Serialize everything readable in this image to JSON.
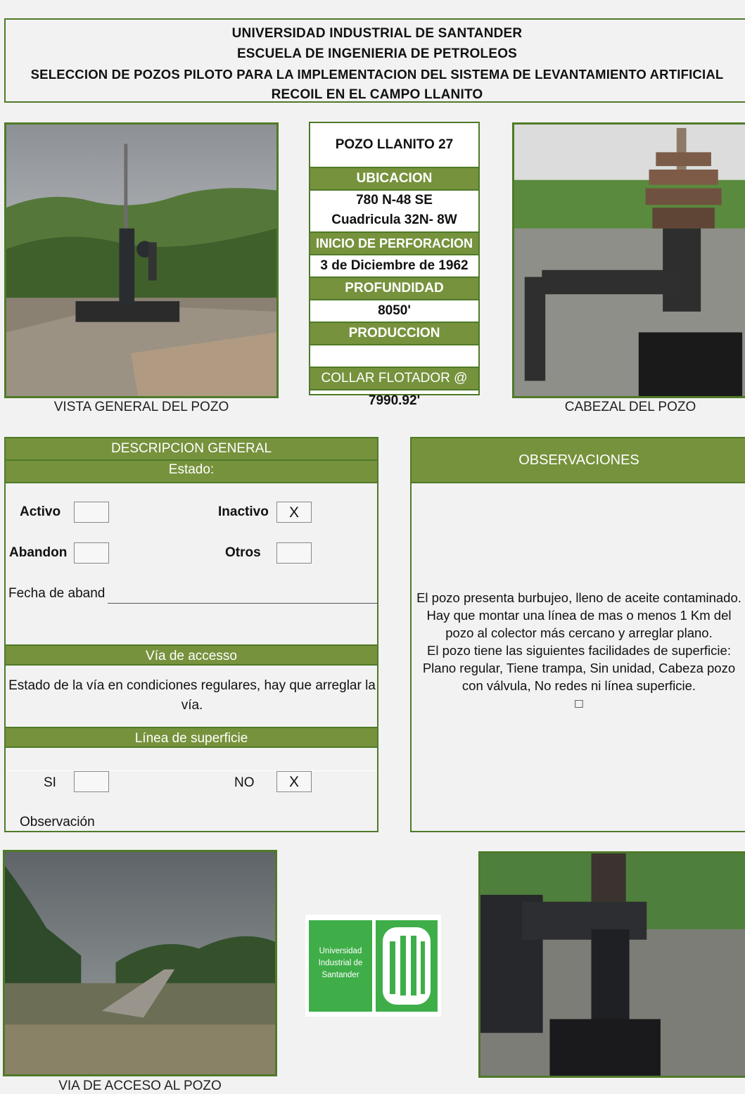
{
  "header": {
    "line1": "UNIVERSIDAD INDUSTRIAL DE SANTANDER",
    "line2": "ESCUELA DE INGENIERIA DE PETROLEOS",
    "line3": "SELECCION DE POZOS PILOTO PARA LA IMPLEMENTACION DEL SISTEMA DE LEVANTAMIENTO ARTIFICIAL",
    "line4": "RECOIL EN EL CAMPO LLANITO"
  },
  "well_card": {
    "name": "POZO LLANITO 27",
    "ubicacion_label": "UBICACION",
    "ubicacion_1": "780 N-48 SE",
    "ubicacion_2": "Cuadricula 32N- 8W",
    "inicio_label": "INICIO DE PERFORACION",
    "inicio_value": "3 de Diciembre de 1962",
    "profundidad_label": "PROFUNDIDAD",
    "profundidad_value": "8050'",
    "produccion_label": "PRODUCCION",
    "produccion_value": "",
    "collar_label": "COLLAR FLOTADOR @",
    "collar_value": "7990.92'"
  },
  "captions": {
    "vista_general": "VISTA GENERAL DEL POZO",
    "cabezal": "CABEZAL DEL POZO",
    "via_acceso": "VIA DE ACCESO AL POZO"
  },
  "description": {
    "title": "DESCRIPCION GENERAL",
    "estado_label": "Estado:",
    "activo_label": "Activo",
    "activo_value": "",
    "inactivo_label": "Inactivo",
    "inactivo_value": "X",
    "abandon_label": "Abandon",
    "abandon_value": "",
    "otros_label": "Otros",
    "otros_value": "",
    "fecha_label": "Fecha de aband",
    "via_title": "Vía de accesso",
    "via_text": "Estado de la vía en condiciones regulares, hay que arreglar la vía.",
    "linea_title": "Línea de superficie",
    "si_label": "SI",
    "si_value": "",
    "no_label": "NO",
    "no_value": "X",
    "observacion_label": "Observación"
  },
  "observations": {
    "title": "OBSERVACIONES",
    "line1": "El pozo presenta burbujeo, lleno de aceite contaminado.",
    "line2": "Hay que montar una línea de mas o menos 1 Km del",
    "line3": "pozo al colector más cercano y arreglar plano.",
    "line4": "El pozo tiene las siguientes facilidades de superficie:",
    "line5": "Plano regular, Tiene trampa, Sin unidad,  Cabeza pozo",
    "line6": "con válvula, No redes ni línea superficie.",
    "line7": "□"
  },
  "logo": {
    "text1": "Universidad",
    "text2": "Industrial de",
    "text3": "Santander"
  },
  "colors": {
    "accent_green": "#76923c",
    "border_green": "#4f7a28",
    "logo_green": "#3fae49"
  }
}
